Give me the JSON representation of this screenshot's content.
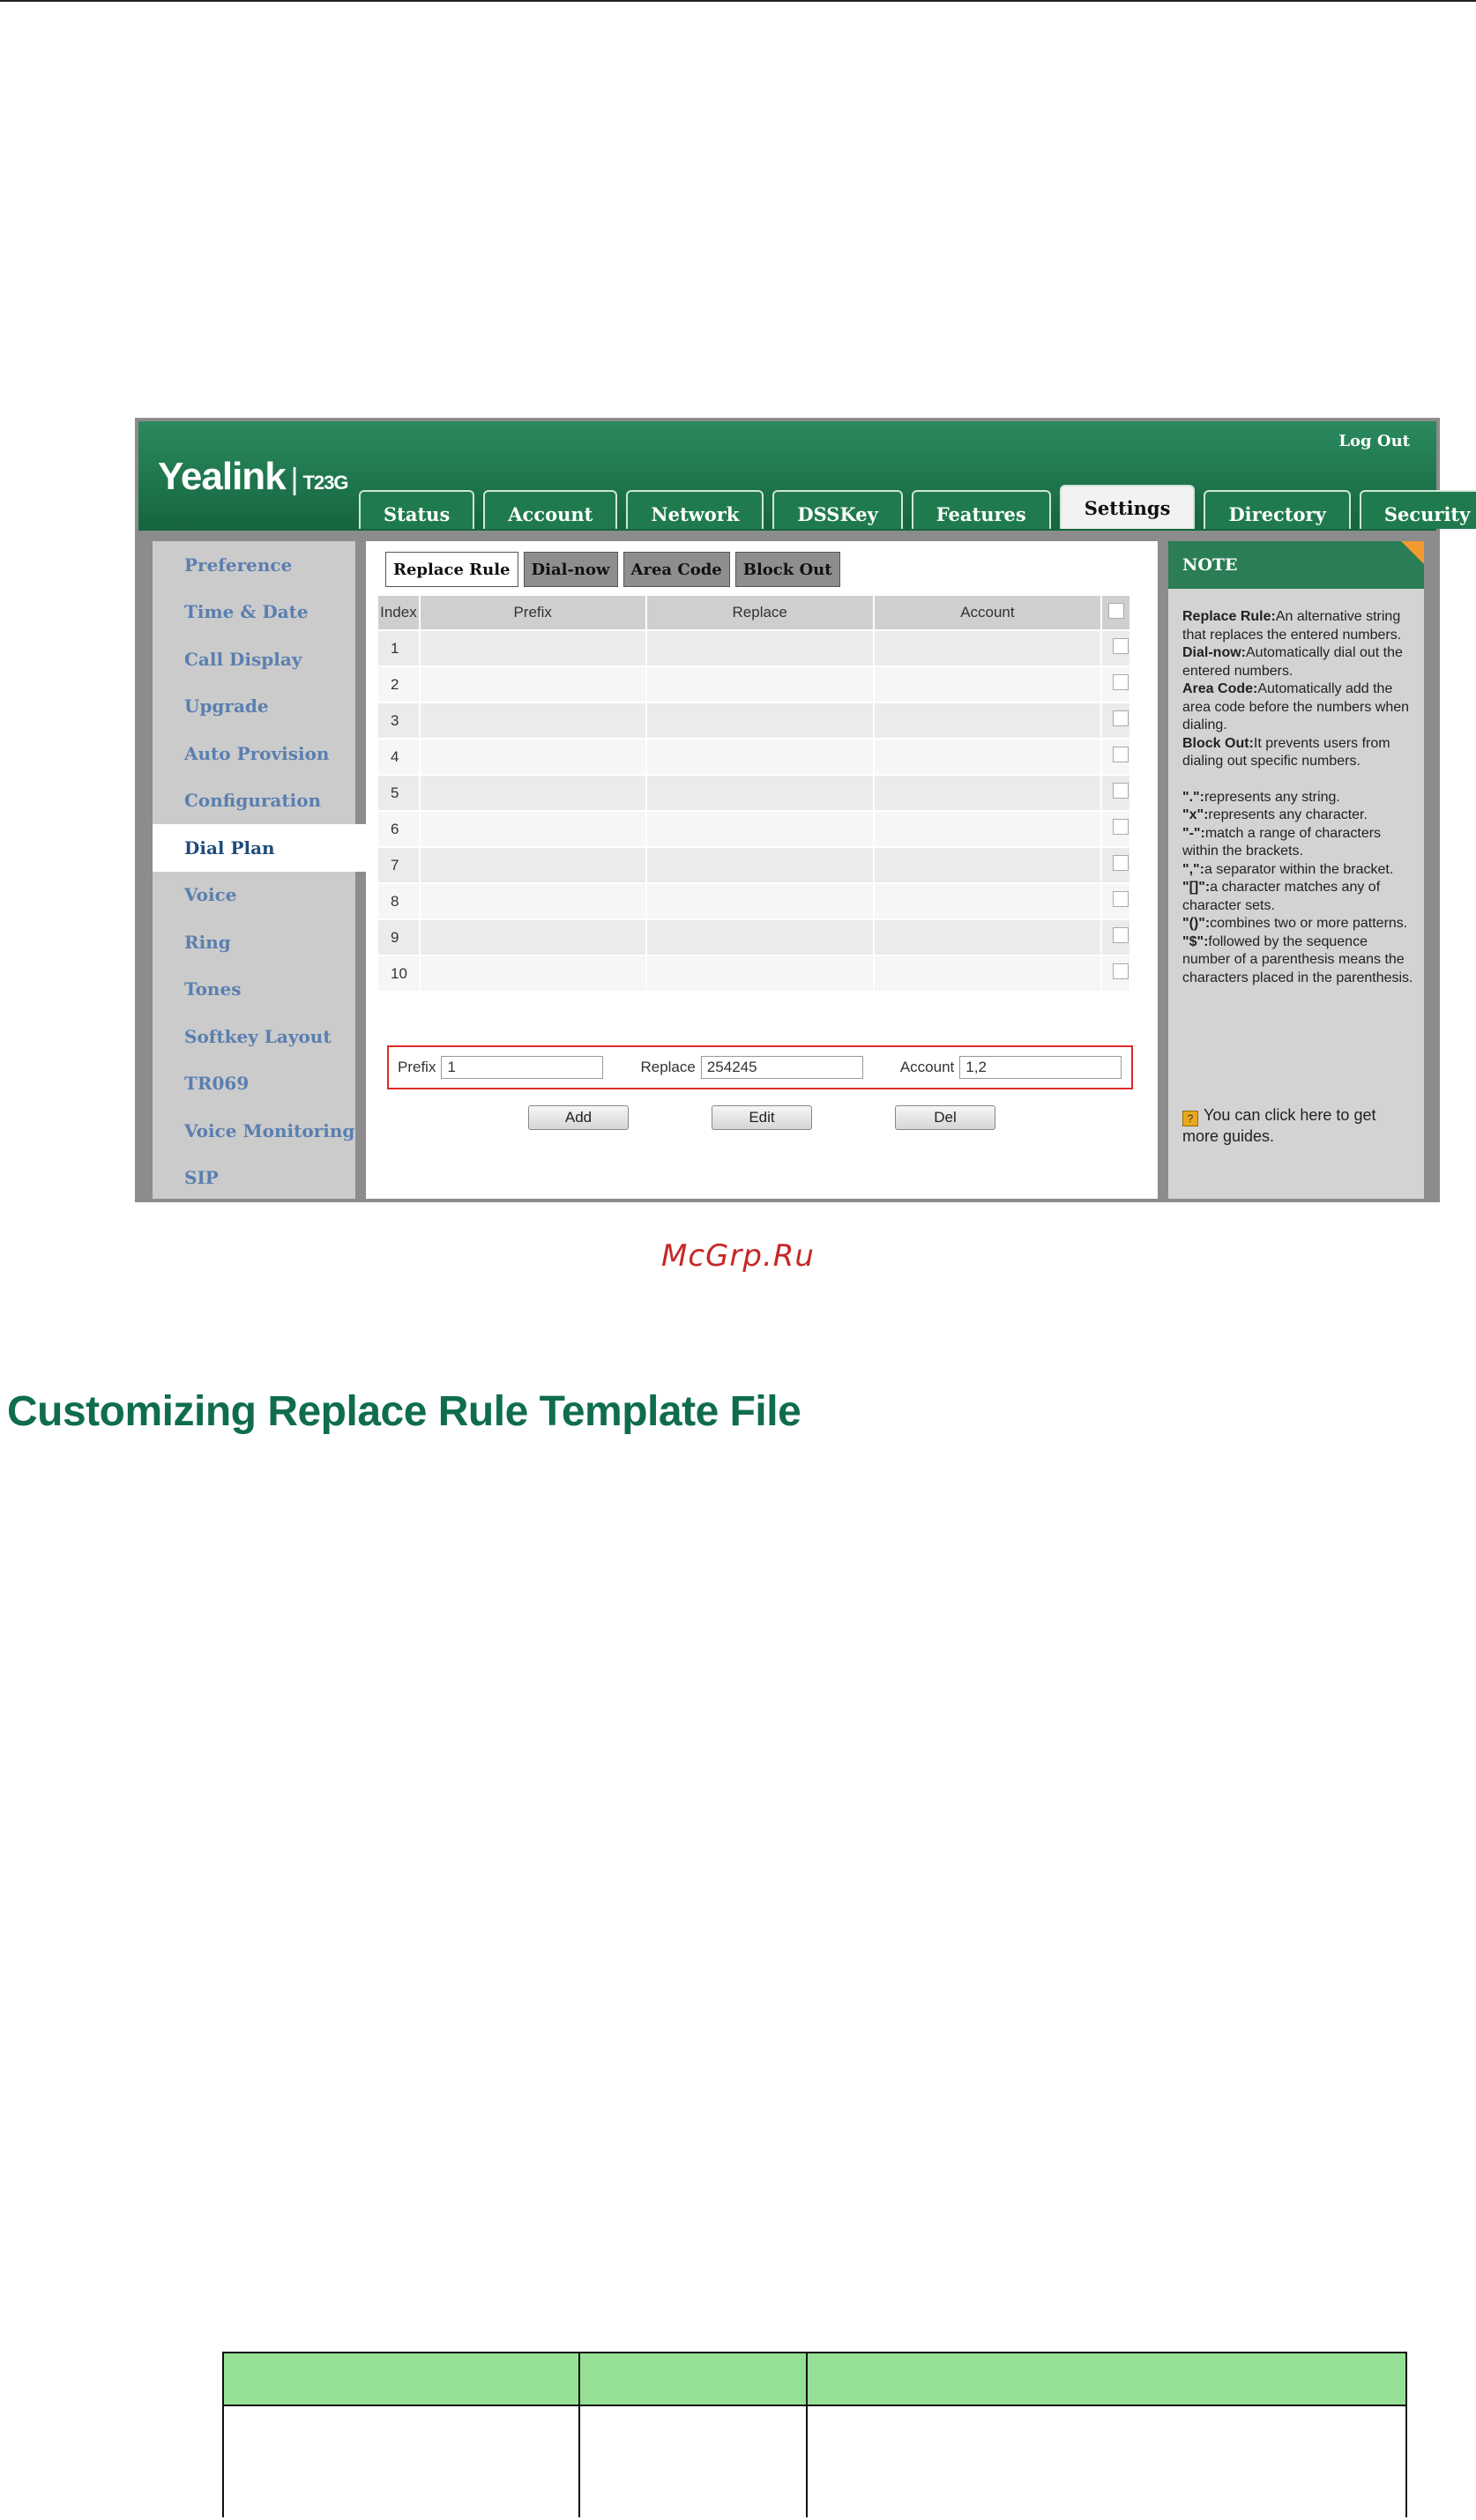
{
  "header": {
    "logo": "Yealink",
    "logo_sep": "|",
    "model": "T23G",
    "logout": "Log Out"
  },
  "tabs": [
    {
      "label": "Status"
    },
    {
      "label": "Account"
    },
    {
      "label": "Network"
    },
    {
      "label": "DSSKey"
    },
    {
      "label": "Features"
    },
    {
      "label": "Settings",
      "active": true
    },
    {
      "label": "Directory"
    },
    {
      "label": "Security"
    }
  ],
  "sidebar": {
    "items": [
      {
        "label": "Preference"
      },
      {
        "label": "Time & Date"
      },
      {
        "label": "Call Display"
      },
      {
        "label": "Upgrade"
      },
      {
        "label": "Auto Provision"
      },
      {
        "label": "Configuration"
      },
      {
        "label": "Dial Plan",
        "active": true
      },
      {
        "label": "Voice"
      },
      {
        "label": "Ring"
      },
      {
        "label": "Tones"
      },
      {
        "label": "Softkey Layout"
      },
      {
        "label": "TR069"
      },
      {
        "label": "Voice Monitoring"
      },
      {
        "label": "SIP"
      }
    ]
  },
  "subtabs": [
    {
      "label": "Replace Rule",
      "active": true
    },
    {
      "label": "Dial-now"
    },
    {
      "label": "Area Code"
    },
    {
      "label": "Block Out"
    }
  ],
  "table": {
    "headers": [
      "Index",
      "Prefix",
      "Replace",
      "Account"
    ],
    "rows": [
      "1",
      "2",
      "3",
      "4",
      "5",
      "6",
      "7",
      "8",
      "9",
      "10"
    ]
  },
  "form": {
    "prefix_label": "Prefix",
    "prefix_value": "1",
    "replace_label": "Replace",
    "replace_value": "254245",
    "account_label": "Account",
    "account_value": "1,2"
  },
  "buttons": {
    "add": "Add",
    "edit": "Edit",
    "del": "Del"
  },
  "note": {
    "title": "NOTE",
    "items": [
      {
        "term": "Replace Rule:",
        "text": "An alternative string that replaces the entered numbers."
      },
      {
        "term": "Dial-now:",
        "text": "Automatically dial out the entered numbers."
      },
      {
        "term": "Area Code:",
        "text": "Automatically add the area code before the numbers when dialing."
      },
      {
        "term": "Block Out:",
        "text": "It prevents users from dialing out specific numbers."
      }
    ],
    "symbols": [
      {
        "term": "\".\":",
        "text": "represents any string."
      },
      {
        "term": "\"x\":",
        "text": "represents any character."
      },
      {
        "term": "\"-\":",
        "text": "match a range of characters within the brackets."
      },
      {
        "term": "\",\":",
        "text": "a separator within the bracket."
      },
      {
        "term": "\"[]\":",
        "text": "a character matches any of character sets."
      },
      {
        "term": "\"()\":",
        "text": "combines two or more patterns."
      },
      {
        "term": "\"$\":",
        "text": "followed by the sequence number of a parenthesis means the characters placed in the parenthesis."
      }
    ],
    "guide": "You can click here to get more guides."
  },
  "watermark": "McGrp.Ru",
  "heading": "Customizing Replace Rule Template File"
}
